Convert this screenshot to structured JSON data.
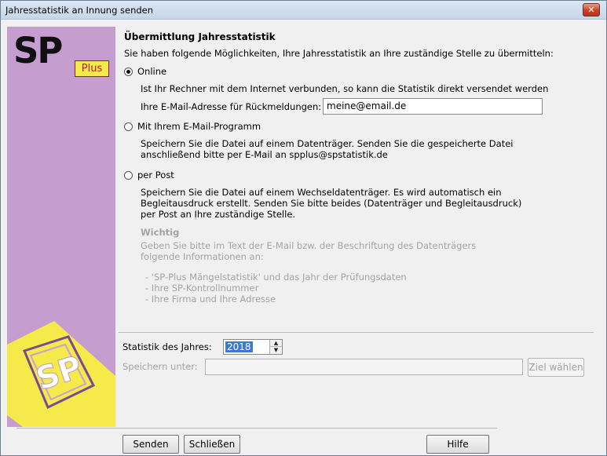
{
  "window": {
    "title": "Jahresstatistik an Innung senden",
    "close_glyph": "✕"
  },
  "logo": {
    "sp": "SP",
    "plus": "Plus",
    "big_text": "SP",
    "colors": {
      "sidebar": "#c59ecf",
      "yellow": "#f6ea4a",
      "red": "#b21c2a"
    }
  },
  "content": {
    "heading": "Übermittlung Jahresstatistik",
    "intro": "Sie haben folgende Möglichkeiten, Ihre Jahresstatistik an Ihre zuständige Stelle zu übermitteln:",
    "online": {
      "label": "Online",
      "selected": true,
      "line1": "Ist Ihr Rechner mit dem Internet verbunden, so kann die Statistik direkt versendet werden",
      "email_label": "Ihre E-Mail-Adresse für Rückmeldungen:",
      "email_value": "meine@email.de"
    },
    "email_program": {
      "label": "Mit Ihrem E-Mail-Programm",
      "selected": false,
      "line1": "Speichern Sie die Datei auf einem Datenträger. Senden Sie die  gespeicherte Datei",
      "line2": "anschließend bitte per E-Mail an spplus@spstatistik.de"
    },
    "post": {
      "label": "per Post",
      "selected": false,
      "line1": "Speichern Sie die Datei auf einem Wechseldatenträger. Es wird  automatisch ein",
      "line2": "Begleitausdruck erstellt. Senden Sie bitte beides (Datenträger und  Begleitausdruck)",
      "line3": "per Post an Ihre zuständige Stelle."
    },
    "important": {
      "title": "Wichtig",
      "line1": "Geben Sie bitte im Text der E-Mail bzw. der Beschriftung des Datenträgers",
      "line2": "folgende Informationen an:",
      "items": [
        "- 'SP-Plus Mängelstatistik' und das Jahr der Prüfungsdaten",
        "- Ihre SP-Kontrollnummer",
        "- Ihre Firma und Ihre Adresse"
      ]
    }
  },
  "year": {
    "label": "Statistik des Jahres:",
    "value": "2018"
  },
  "save": {
    "label": "Speichern unter:",
    "path": "",
    "button": "Ziel wählen"
  },
  "buttons": {
    "send": "Senden",
    "close": "Schließen",
    "help": "Hilfe"
  }
}
